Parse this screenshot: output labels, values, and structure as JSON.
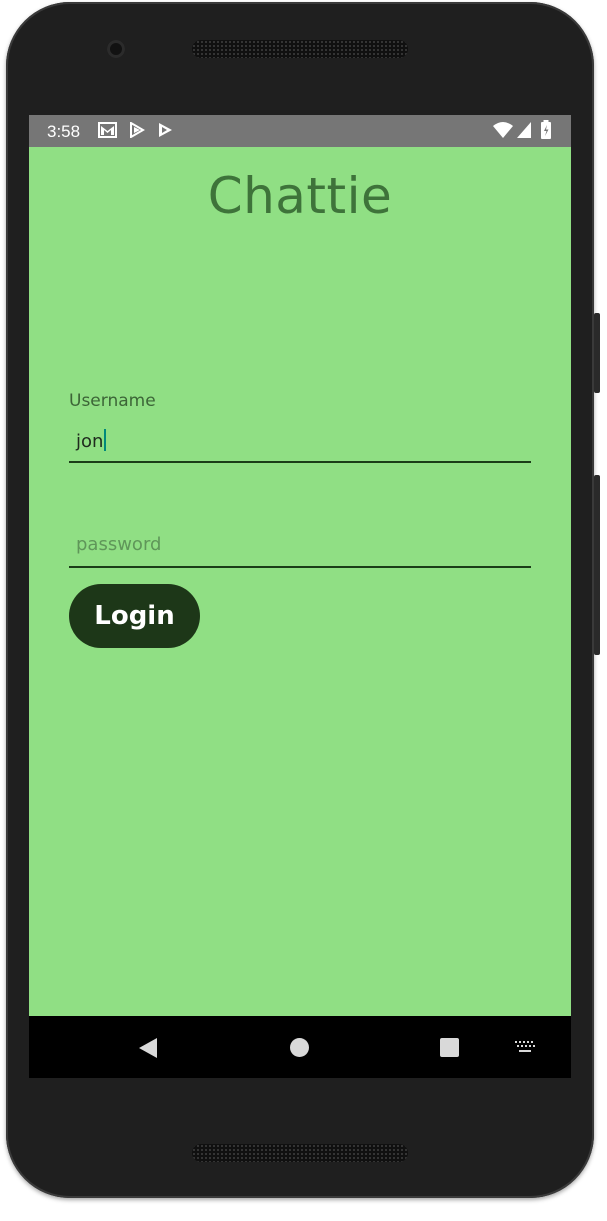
{
  "status_bar": {
    "time": "3:58",
    "left_icons": [
      "gmail-icon",
      "play-store-icon",
      "play-icon"
    ],
    "right_icons": [
      "wifi-icon",
      "cell-signal-icon",
      "battery-icon"
    ]
  },
  "app": {
    "title": "Chattie"
  },
  "form": {
    "username_label": "Username",
    "username_value": "jon",
    "password_placeholder": "password",
    "password_value": "",
    "login_label": "Login"
  },
  "nav_bar": {
    "icons": [
      "back-icon",
      "home-icon",
      "recents-icon",
      "keyboard-icon"
    ]
  },
  "colors": {
    "background": "#90df84",
    "title": "#3e733a",
    "button": "#1d3718",
    "status_bar": "#767676",
    "caret": "#00897b"
  }
}
